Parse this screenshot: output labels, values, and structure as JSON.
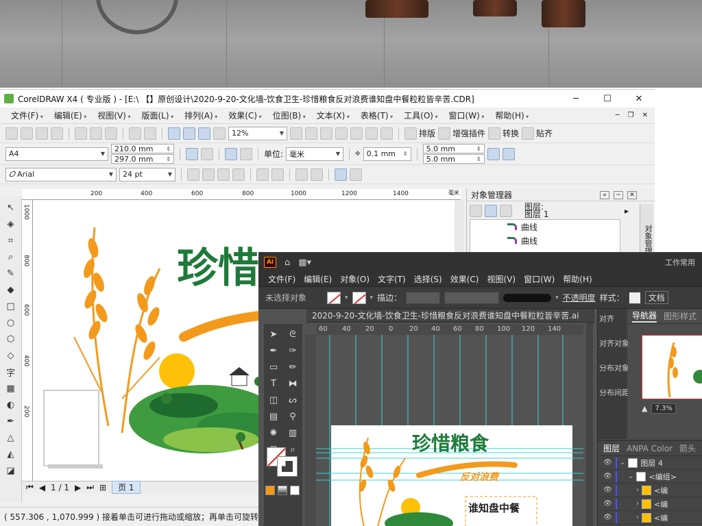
{
  "corel": {
    "title": "CorelDRAW X4 ( 专业版 ) - [E:\\ 【】原创设计\\2020-9-20-文化墙-饮食卫生-珍惜粮食反对浪费谁知盘中餐粒粒皆辛苦.CDR]",
    "menu": [
      "文件(F)",
      "编辑(E)",
      "视图(V)",
      "版面(L)",
      "排列(A)",
      "效果(C)",
      "位图(B)",
      "文本(X)",
      "表格(T)",
      "工具(O)",
      "窗口(W)",
      "帮助(H)"
    ],
    "toolbar": {
      "zoom": "12%",
      "paizhuan": "排版",
      "plugin": "增强插件",
      "convert": "转换",
      "paste": "贴齐"
    },
    "property": {
      "paper": "A4",
      "width": "210.0 mm",
      "height": "297.0 mm",
      "unit_label": "单位:",
      "unit": "毫米",
      "nudge": "0.1 mm",
      "dup_x": "5.0 mm",
      "dup_y": "5.0 mm"
    },
    "textbar": {
      "font": "Arial",
      "size": "24 pt"
    },
    "ruler_h": [
      "200",
      "400",
      "600",
      "800",
      "1000",
      "1200",
      "1400",
      "毫米"
    ],
    "ruler_v": [
      "1000",
      "800",
      "600",
      "400",
      "200"
    ],
    "pagebar": {
      "count": "1 / 1",
      "tab": "页 1"
    },
    "objmgr": {
      "title": "对象管理器",
      "layer1": "图层:",
      "layer2": "图层 1",
      "items": [
        "曲线",
        "曲线"
      ]
    },
    "dock_label": "对象管理器",
    "status": "( 557.306 , 1,070.999 )  接着单击可进行拖动或缩放；再单击可旋转或倾斜；"
  },
  "illustrator": {
    "logo": "Ai",
    "workspace": "工作常用",
    "menu": [
      "文件(F)",
      "编辑(E)",
      "对象(O)",
      "文字(T)",
      "选择(S)",
      "效果(C)",
      "视图(V)",
      "窗口(W)",
      "帮助(H)"
    ],
    "control": {
      "no_selection": "未选择对象",
      "stroke_label": "描边：",
      "opacity_label": "不透明度",
      "style_label": "样式：",
      "doc_label": "文档"
    },
    "doc_tab": "2020-9-20-文化墙-饮食卫生-珍惜粮食反对浪费谁知盘中餐粒粒皆辛苦.ai",
    "ruler_h": [
      "60",
      "40",
      "20",
      "0",
      "20",
      "40",
      "60",
      "80",
      "100",
      "120",
      "140"
    ],
    "panels": {
      "align": "对齐",
      "align_obj": "对齐对象",
      "distribute_obj": "分布对象",
      "distribute_spacing": "分布间距",
      "navigator": "导航器",
      "graphic_styles": "图形样式",
      "zoom": "7.3%",
      "layers_tab": "图层",
      "anpa": "ANPA Color",
      "arrow_tab": "箭头",
      "layer_name": "图层 4",
      "group": "<编组>",
      "sub_items": [
        "<编",
        "<编",
        "<编"
      ]
    }
  },
  "artwork": {
    "title": "珍惜粮食",
    "subtitle": "反对浪费",
    "line1": "谁知盘中餐"
  },
  "colors": {
    "green": "#1f7a3a",
    "orange": "#f39a1c",
    "ai_dark": "#535353",
    "corel_bg": "#f0f0f0"
  }
}
